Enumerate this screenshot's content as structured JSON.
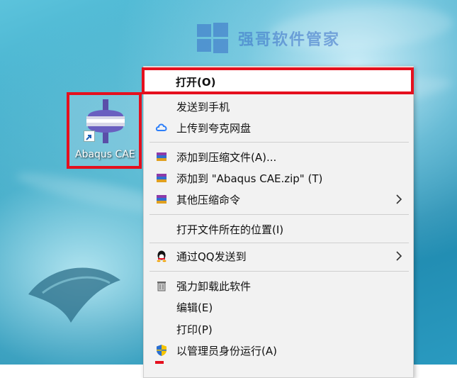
{
  "watermark": {
    "text": "强哥软件管家"
  },
  "desktop_icon": {
    "label": "Abaqus CAE",
    "icon": "abaqus-cae-icon"
  },
  "context_menu": {
    "items": [
      {
        "label": "打开(O)",
        "icon": "",
        "highlighted": true
      },
      {
        "label": "发送到手机",
        "icon": ""
      },
      {
        "label": "上传到夸克网盘",
        "icon": "cloud-icon"
      },
      {
        "label": "添加到压缩文件(A)...",
        "icon": "winrar-icon"
      },
      {
        "label": "添加到 \"Abaqus CAE.zip\" (T)",
        "icon": "winrar-icon"
      },
      {
        "label": "其他压缩命令",
        "icon": "winrar-icon",
        "submenu": true
      },
      {
        "label": "打开文件所在的位置(I)",
        "icon": ""
      },
      {
        "label": "通过QQ发送到",
        "icon": "qq-icon",
        "submenu": true
      },
      {
        "label": "强力卸载此软件",
        "icon": "trash-icon"
      },
      {
        "label": "编辑(E)",
        "icon": ""
      },
      {
        "label": "打印(P)",
        "icon": ""
      },
      {
        "label": "以管理员身份运行(A)",
        "icon": "shield-icon"
      }
    ]
  },
  "colors": {
    "highlight_border": "#e5101e",
    "menu_bg": "#f2f2f2"
  }
}
